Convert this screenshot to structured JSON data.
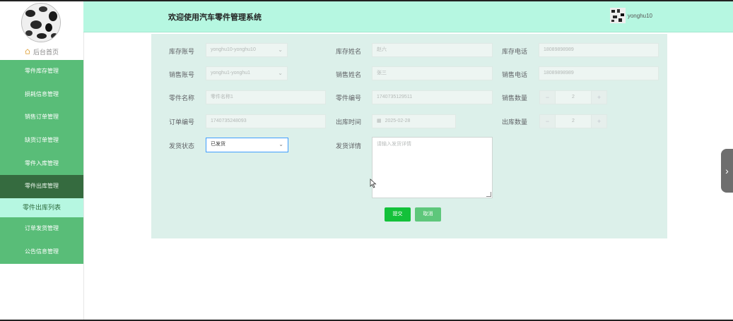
{
  "header": {
    "title": "欢迎使用汽车零件管理系统",
    "username": "yonghu10"
  },
  "sidebar": {
    "home_label": "后台首页",
    "items": [
      {
        "label": "零件库存管理",
        "active": false
      },
      {
        "label": "损耗信息管理",
        "active": false
      },
      {
        "label": "销售订单管理",
        "active": false
      },
      {
        "label": "缺货订单管理",
        "active": false
      },
      {
        "label": "零件入库管理",
        "active": false
      },
      {
        "label": "零件出库管理",
        "active": true
      }
    ],
    "submenu": {
      "label": "零件出库列表"
    },
    "items_after": [
      {
        "label": "订单发货管理"
      },
      {
        "label": "公告信息管理"
      }
    ]
  },
  "form": {
    "inventory_account": {
      "label": "库存账号",
      "value": "yonghu10-yonghu10"
    },
    "inventory_name": {
      "label": "库存姓名",
      "value": "赵六"
    },
    "inventory_phone": {
      "label": "库存电话",
      "value": "18089898989"
    },
    "sales_account": {
      "label": "销售账号",
      "value": "yonghu1-yonghu1"
    },
    "sales_name": {
      "label": "销售姓名",
      "value": "张三"
    },
    "sales_phone": {
      "label": "销售电话",
      "value": "18089898989"
    },
    "part_name": {
      "label": "零件名称",
      "value": "零件名称1"
    },
    "part_number": {
      "label": "零件编号",
      "value": "1740735129511"
    },
    "sales_quantity": {
      "label": "销售数量",
      "value": "2",
      "minus": "−",
      "plus": "+"
    },
    "order_number": {
      "label": "订单编号",
      "value": "1740735248093"
    },
    "outbound_time": {
      "label": "出库时间",
      "value": "2025-02-28"
    },
    "outbound_quantity": {
      "label": "出库数量",
      "value": "2",
      "minus": "−",
      "plus": "+"
    },
    "shipping_status": {
      "label": "发货状态",
      "value": "已发货"
    },
    "shipping_details": {
      "label": "发货详情",
      "placeholder": "请输入发货详情"
    },
    "submit_label": "提交",
    "cancel_label": "取消"
  },
  "colors": {
    "header_bg": "#b6f7e1",
    "menu_bg": "#59bd78",
    "menu_active_bg": "#356b3f",
    "panel_bg": "#dcf0ea",
    "submit_bg": "#13c13a",
    "cancel_bg": "#5ec77b"
  }
}
